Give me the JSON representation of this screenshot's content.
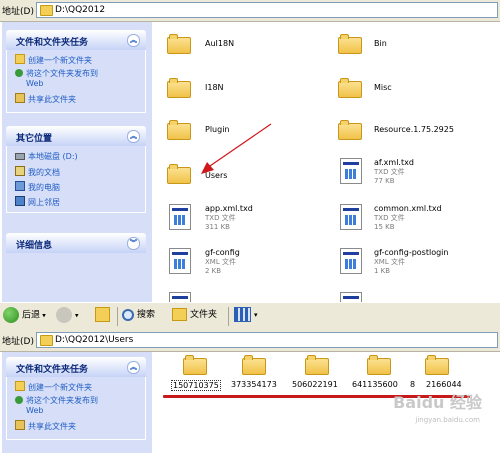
{
  "top_address": {
    "label": "地址(D)",
    "path": "D:\\QQ2012"
  },
  "bottom_address": {
    "label": "地址(D)",
    "path": "D:\\QQ2012\\Users"
  },
  "task_panel": {
    "title": "文件和文件夹任务",
    "items": [
      "创建一个新文件夹",
      "将这个文件夹发布到",
      "Web",
      "共享此文件夹"
    ]
  },
  "other_places": {
    "title": "其它位置",
    "items": [
      "本地磁盘 (D:)",
      "我的文档",
      "我的电脑",
      "网上邻居"
    ]
  },
  "details": {
    "title": "详细信息"
  },
  "files": [
    {
      "name": "AuI18N",
      "type": "folder"
    },
    {
      "name": "Bin",
      "type": "folder"
    },
    {
      "name": "I18N",
      "type": "folder"
    },
    {
      "name": "Misc",
      "type": "folder"
    },
    {
      "name": "Plugin",
      "type": "folder"
    },
    {
      "name": "Resource.1.75.2925",
      "type": "folder"
    },
    {
      "name": "Users",
      "type": "folder"
    },
    {
      "name": "af.xml.txd",
      "type": "file",
      "kind": "TXD 文件",
      "size": "77 KB"
    },
    {
      "name": "app.xml.txd",
      "type": "file",
      "kind": "TXD 文件",
      "size": "311 KB"
    },
    {
      "name": "common.xml.txd",
      "type": "file",
      "kind": "TXD 文件",
      "size": "15 KB"
    },
    {
      "name": "gf-config",
      "type": "file",
      "kind": "XML 文件",
      "size": "2 KB"
    },
    {
      "name": "gf-config-postlogin",
      "type": "file",
      "kind": "XML 文件",
      "size": "1 KB"
    }
  ],
  "toolbar": {
    "back": "后退",
    "search": "搜索",
    "folders": "文件夹"
  },
  "user_folders": [
    "150710375",
    "373354173",
    "506022191",
    "641135600",
    "8",
    "2166044"
  ],
  "watermark": {
    "brand": "Baidu 经验",
    "url": "jingyan.baidu.com"
  },
  "colors": {
    "accent_line": "#c61a1a",
    "pane_bg": "#d6dff7",
    "arrow": "#d0171b"
  }
}
